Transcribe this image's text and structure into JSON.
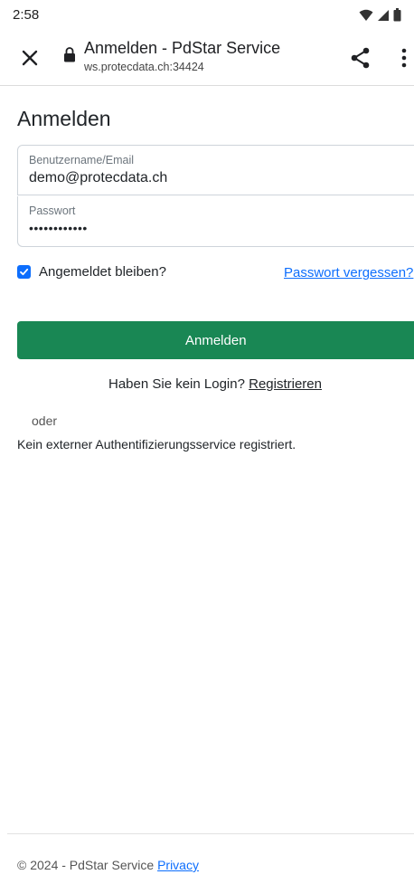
{
  "status_bar": {
    "time": "2:58",
    "icons": [
      "wifi-icon",
      "signal-icon",
      "battery-icon"
    ]
  },
  "browser": {
    "page_title": "Anmelden - PdStar Service",
    "url": "ws.protecdata.ch:34424",
    "icons": [
      "close-icon",
      "lock-icon",
      "share-icon",
      "more-vert-icon"
    ]
  },
  "form": {
    "heading": "Anmelden",
    "username_label": "Benutzername/Email",
    "username_value": "demo@protecdata.ch",
    "password_label": "Passwort",
    "password_value": "••••••••••••",
    "remember_label": "Angemeldet bleiben?",
    "remember_checked": true,
    "forgot_link": "Passwort vergessen?",
    "submit_label": "Anmelden",
    "register_prompt": "Haben Sie kein Login?",
    "register_link": "Registrieren",
    "or_text": "oder",
    "external_auth_text": "Kein externer Authentifizierungsservice registriert."
  },
  "footer": {
    "copyright": "© 2024 - PdStar Service",
    "privacy_link": "Privacy"
  },
  "colors": {
    "primary_link": "#0d6efd",
    "submit_button": "#198754",
    "checkbox": "#0d6efd"
  }
}
